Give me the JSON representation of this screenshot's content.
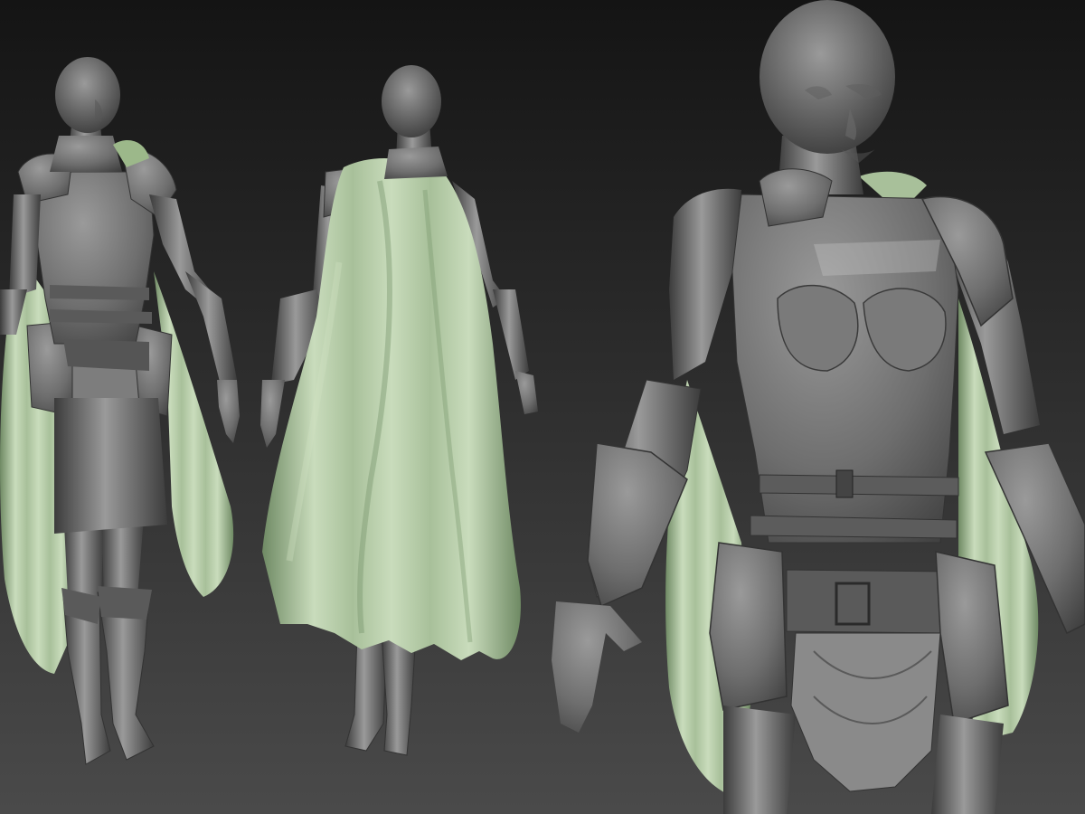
{
  "scene": {
    "background_top": "#141414",
    "background_bottom": "#4a4a4a",
    "clay_color": "#6e6e6e",
    "clay_dark": "#3c3c3c",
    "clay_light": "#9a9a9a",
    "cloak_color": "#a8c09a",
    "cloak_dark": "#6f8a64",
    "cloak_light": "#c9dcbc"
  },
  "views": [
    {
      "view": "front-full"
    },
    {
      "view": "back-full"
    },
    {
      "view": "front-closeup"
    }
  ]
}
